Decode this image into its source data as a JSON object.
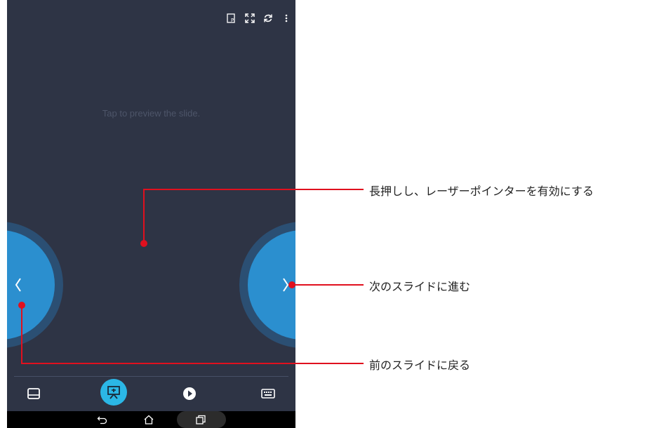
{
  "screen": {
    "top_icons": [
      "presenter-notes-icon",
      "fullscreen-icon",
      "refresh-icon",
      "overflow-menu-icon"
    ],
    "preview_hint": "Tap to preview the slide.",
    "prev_glyph": "〈",
    "next_glyph": "〉",
    "bottom_tabs": [
      {
        "name": "touchpad-tab",
        "icon": "touchpad-icon",
        "active": false
      },
      {
        "name": "presentation-tab",
        "icon": "presentation-icon",
        "active": true
      },
      {
        "name": "play-tab",
        "icon": "play-icon",
        "active": false
      },
      {
        "name": "keyboard-tab",
        "icon": "keyboard-icon",
        "active": false
      }
    ],
    "system_nav": [
      "back-icon",
      "home-icon",
      "recent-apps-icon"
    ]
  },
  "annotations": {
    "laser": "長押しし、レーザーポインターを有効にする",
    "next": "次のスライドに進む",
    "prev": "前のスライドに戻る"
  },
  "colors": {
    "screen_bg": "#2e3445",
    "nav_circle": "#2b8fcf",
    "nav_ring": "#2b4f73",
    "active_tab": "#2bb7e6",
    "callout": "#e0101e"
  }
}
